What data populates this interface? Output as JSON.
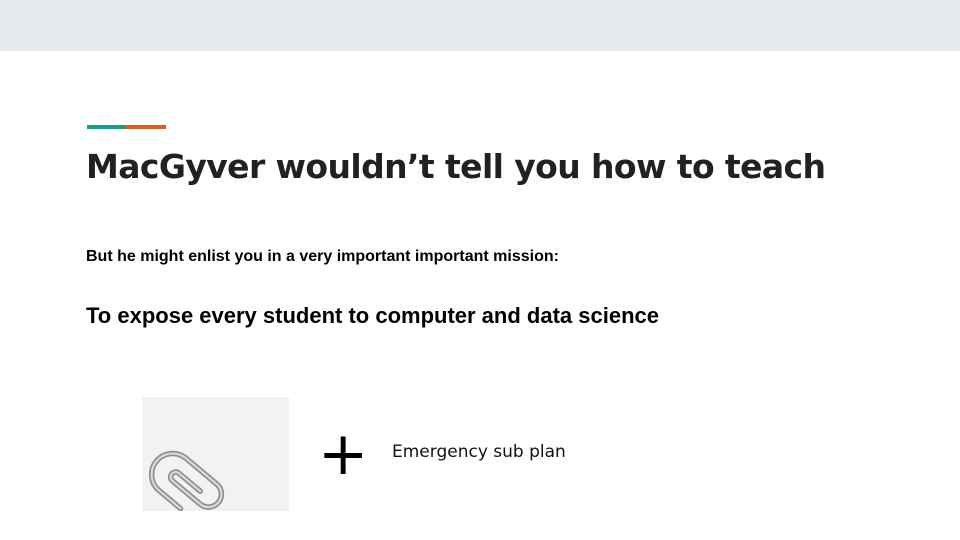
{
  "slide": {
    "title": "MacGyver wouldn’t tell you how to teach",
    "subtitle": "But he might enlist you in a very important important mission:",
    "mission": "To expose every student to computer and data science",
    "plus_symbol": "+",
    "caption": "Emergency sub plan"
  },
  "colors": {
    "top_band": "#e8ebed",
    "accent_teal": "#1b9a8e",
    "accent_orange": "#e05f18",
    "title_text": "#212121"
  },
  "icons": {
    "image": "paperclip-icon"
  }
}
